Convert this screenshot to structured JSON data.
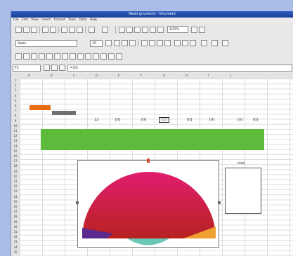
{
  "window": {
    "title": "Neatl.gnumeric - Gnumeric"
  },
  "menubar": [
    "File",
    "Edit",
    "View",
    "Insert",
    "Format",
    "Tools",
    "Data",
    "Help"
  ],
  "toolbar": {
    "zoom_value": "100%"
  },
  "format_bar": {
    "font_name": "Sans",
    "font_size": "10"
  },
  "formula_bar": {
    "cell_ref": "F1",
    "formula": "=(D)"
  },
  "sheet": {
    "columns": [
      "A",
      "B",
      "C",
      "D",
      "E",
      "F",
      "G",
      "H",
      "I",
      "J"
    ],
    "rows": [
      "1",
      "2",
      "3",
      "4",
      "5",
      "6",
      "7",
      "8",
      "9",
      "10",
      "11",
      "12",
      "13",
      "14",
      "15",
      "16",
      "17",
      "18",
      "19",
      "20",
      "21",
      "22",
      "23",
      "24",
      "25",
      "26",
      "27",
      "28",
      "29",
      "30",
      "31",
      "32",
      "33",
      "34",
      "35"
    ],
    "row3_values": [
      "12",
      "[0]",
      "[0]",
      "[1]",
      "[0]",
      "[0]",
      "[0]",
      "[0]",
      "[0]"
    ],
    "side_label": "chal",
    "colors": {
      "orange": "#ea6a10",
      "gray": "#6f6f6f",
      "green": "#5cbb3a",
      "pink": "#de1a69",
      "red": "#b8241f",
      "orange_fill": "#f0a030",
      "purple": "#5a2a90",
      "teal": "#6ac7b6"
    }
  }
}
